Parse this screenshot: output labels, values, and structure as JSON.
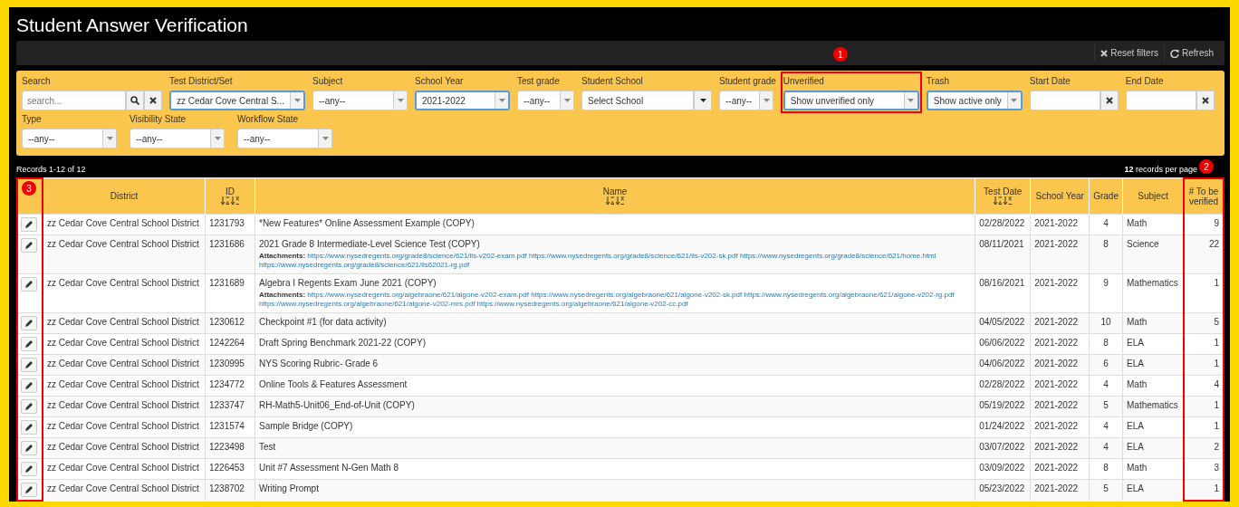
{
  "window": {
    "title": "Student Answer Verification"
  },
  "toolbar": {
    "buttons": [
      {
        "kind": "reset",
        "label": "Reset filters"
      },
      {
        "kind": "refresh",
        "label": "Refresh"
      }
    ]
  },
  "filter_rows": [
    [
      {
        "kind": "search",
        "label": "Search",
        "placeholder": "search...",
        "focused": false
      },
      {
        "kind": "select",
        "label": "Test District/Set",
        "value": "zz Cedar Cove Central S...",
        "focused": true
      },
      {
        "kind": "select",
        "label": "Subject",
        "value": "--any--",
        "focused": false
      },
      {
        "kind": "select",
        "label": "School Year",
        "value": "2021-2022",
        "focused": true
      },
      {
        "kind": "select",
        "label": "Test grade",
        "value": "--any--",
        "focused": false
      },
      {
        "kind": "dropdown",
        "label": "Student School",
        "value": "Select School",
        "focused": false
      },
      {
        "kind": "select",
        "label": "Student grade",
        "value": "--any--",
        "focused": false
      },
      {
        "kind": "select",
        "label": "Unverified",
        "value": "Show unverified only",
        "focused": true,
        "callout": "1"
      },
      {
        "kind": "select",
        "label": "Trash",
        "value": "Show active only",
        "focused": true
      },
      {
        "kind": "date",
        "label": "Start Date",
        "focused": false
      },
      {
        "kind": "date",
        "label": "End Date",
        "focused": false
      }
    ],
    [
      {
        "kind": "select",
        "label": "Type",
        "value": "--any--",
        "focused": false
      },
      {
        "kind": "select",
        "label": "Visibility State",
        "value": "--any--",
        "focused": false
      },
      {
        "kind": "select",
        "label": "Workflow State",
        "value": "--any--",
        "focused": false
      }
    ]
  ],
  "records": {
    "summary": "Records 1-12 of 12",
    "per_page": "**12** records per page"
  },
  "table": {
    "columns": [
      {
        "kind": "edit",
        "sortable": false,
        "callout": "3"
      },
      {
        "kind": "district",
        "label": "District",
        "sortable": false
      },
      {
        "kind": "id",
        "label": "ID",
        "sortable": true
      },
      {
        "kind": "name",
        "label": "Name",
        "sortable": true
      },
      {
        "kind": "date",
        "label": "Test Date",
        "sortable": true
      },
      {
        "kind": "year",
        "label": "School Year",
        "sortable": false
      },
      {
        "kind": "grade",
        "label": "Grade",
        "sortable": false
      },
      {
        "kind": "subject",
        "label": "Subject",
        "sortable": false
      },
      {
        "kind": "count",
        "label": "# To be verified",
        "sortable": false,
        "callout": "2"
      }
    ],
    "rows": [
      {
        "district": "zz Cedar Cove Central School District",
        "id": "1231793",
        "name": "*New Features* Online Assessment Example (COPY)",
        "date": "02/28/2022",
        "year": "2021-2022",
        "grade": "4",
        "subject": "Math",
        "count": "9"
      },
      {
        "district": "zz Cedar Cove Central School District",
        "id": "1231686",
        "name": "2021 Grade 8 Intermediate-Level Science Test (COPY)",
        "attachments": {
          "label": "Attachments:",
          "links": [
            "https://www.nysedregents.org/grade8/science/621/ils-v202-exam.pdf",
            "https://www.nysedregents.org/grade8/science/621/ils-v202-sk.pdf",
            "https://www.nysedregents.org/grade8/science/621/home.html",
            "https://www.nysedregents.org/grade8/science/621/ils62021-rg.pdf"
          ]
        },
        "date": "08/11/2021",
        "year": "2021-2022",
        "grade": "8",
        "subject": "Science",
        "count": "22"
      },
      {
        "district": "zz Cedar Cove Central School District",
        "id": "1231689",
        "name": "Algebra I Regents Exam June 2021 (COPY)",
        "attachments": {
          "label": "Attachments:",
          "links": [
            "https://www.nysedregents.org/algebraone/621/algone-v202-exam.pdf",
            "https://www.nysedregents.org/algebraone/621/algone-v202-sk.pdf",
            "https://www.nysedregents.org/algebraone/621/algone-v202-rg.pdf",
            "https://www.nysedregents.org/algebraone/621/algone-v202-mrs.pdf",
            "https://www.nysedregents.org/algebraone/621/algone-v202-cc.pdf"
          ]
        },
        "date": "08/16/2021",
        "year": "2021-2022",
        "grade": "9",
        "subject": "Mathematics",
        "count": "1"
      },
      {
        "district": "zz Cedar Cove Central School District",
        "id": "1230612",
        "name": "Checkpoint #1 (for data activity)",
        "date": "04/05/2022",
        "year": "2021-2022",
        "grade": "10",
        "subject": "Math",
        "count": "5"
      },
      {
        "district": "zz Cedar Cove Central School District",
        "id": "1242264",
        "name": "Draft Spring Benchmark 2021-22 (COPY)",
        "date": "06/06/2022",
        "year": "2021-2022",
        "grade": "8",
        "subject": "ELA",
        "count": "1"
      },
      {
        "district": "zz Cedar Cove Central School District",
        "id": "1230995",
        "name": "NYS Scoring Rubric- Grade 6",
        "date": "04/06/2022",
        "year": "2021-2022",
        "grade": "6",
        "subject": "ELA",
        "count": "1"
      },
      {
        "district": "zz Cedar Cove Central School District",
        "id": "1234772",
        "name": "Online Tools & Features Assessment",
        "date": "02/28/2022",
        "year": "2021-2022",
        "grade": "4",
        "subject": "Math",
        "count": "4"
      },
      {
        "district": "zz Cedar Cove Central School District",
        "id": "1233747",
        "name": "RH-Math5-Unit06_End-of-Unit (COPY)",
        "date": "05/19/2022",
        "year": "2021-2022",
        "grade": "5",
        "subject": "Mathematics",
        "count": "1"
      },
      {
        "district": "zz Cedar Cove Central School District",
        "id": "1231574",
        "name": "Sample Bridge (COPY)",
        "date": "01/24/2022",
        "year": "2021-2022",
        "grade": "4",
        "subject": "ELA",
        "count": "1"
      },
      {
        "district": "zz Cedar Cove Central School District",
        "id": "1223498",
        "name": "Test",
        "date": "03/07/2022",
        "year": "2021-2022",
        "grade": "4",
        "subject": "ELA",
        "count": "2"
      },
      {
        "district": "zz Cedar Cove Central School District",
        "id": "1226453",
        "name": "Unit #7 Assessment N-Gen Math 8",
        "date": "03/09/2022",
        "year": "2021-2022",
        "grade": "8",
        "subject": "Math",
        "count": "3"
      },
      {
        "district": "zz Cedar Cove Central School District",
        "id": "1238702",
        "name": "Writing Prompt",
        "date": "05/23/2022",
        "year": "2021-2022",
        "grade": "5",
        "subject": "ELA",
        "count": "1"
      }
    ]
  }
}
